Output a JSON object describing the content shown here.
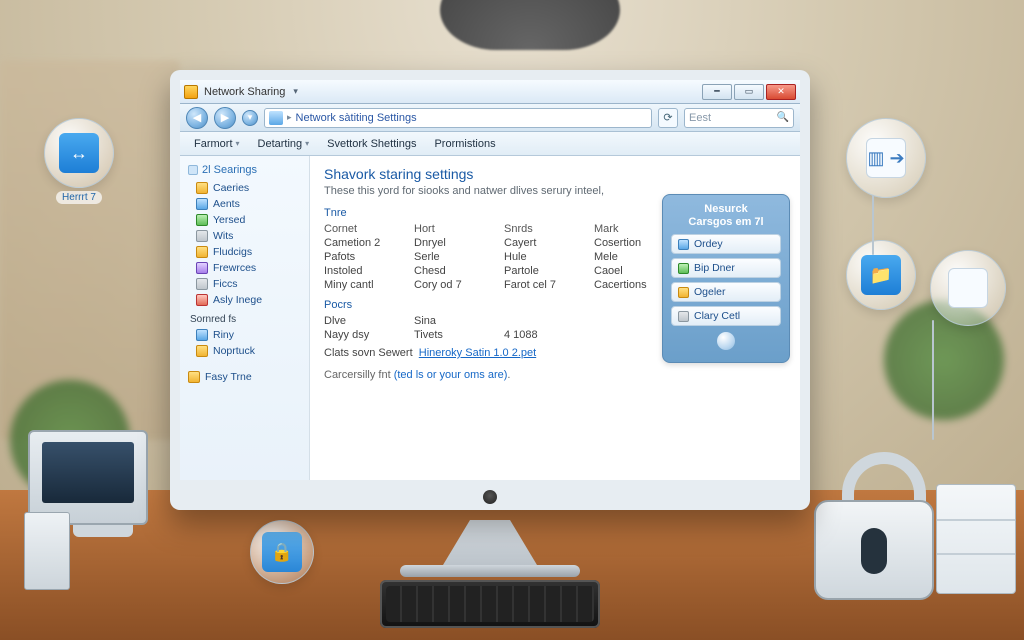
{
  "titlebar": {
    "title": "Network Sharing"
  },
  "breadcrumb": {
    "text": "Network sàtiting Settings"
  },
  "toolbar": {
    "refresh": "⟳",
    "search_placeholder": "Eest"
  },
  "menubar": {
    "items": [
      "Farmort",
      "Detarting",
      "Svettork Shettings",
      "Prormistions"
    ]
  },
  "sidebar": {
    "heading": "2l Searings",
    "items": [
      {
        "icon": "folder",
        "label": "Caeries"
      },
      {
        "icon": "blue",
        "label": "Aents"
      },
      {
        "icon": "green",
        "label": "Yersed"
      },
      {
        "icon": "grey",
        "label": "Wits"
      },
      {
        "icon": "folder",
        "label": "Fludcigs"
      },
      {
        "icon": "purple",
        "label": "Frewrces"
      },
      {
        "icon": "grey",
        "label": "Ficcs"
      },
      {
        "icon": "red",
        "label": "Asly Inege"
      }
    ],
    "subheading": "Sornred fs",
    "sub_items": [
      {
        "icon": "blue",
        "label": "Riny"
      },
      {
        "icon": "folder",
        "label": "Noprtuck"
      }
    ],
    "footer_item": {
      "icon": "folder",
      "label": "Fasy Trne"
    }
  },
  "main": {
    "heading": "Shavork staring settings",
    "desc": "These this yord for siooks and natwer dlives serury inteel,",
    "section1": "Tnre",
    "table": {
      "headers": [
        "Cornet",
        "Hort",
        "Snrds",
        "Mark"
      ],
      "rows": [
        [
          "Cametion 2",
          "Dnryel",
          "Cayert",
          "Cosertion"
        ],
        [
          "Pafots",
          "Serle",
          "Hule",
          "Mele"
        ],
        [
          "Instoled",
          "Chesd",
          "Partole",
          "Caoel"
        ],
        [
          "Miny cantl",
          "Cory od 7",
          "Farot cel 7",
          "Cacertions"
        ]
      ]
    },
    "section2": "Pocrs",
    "table2": {
      "rows": [
        [
          "Dlve",
          "Sina",
          ""
        ],
        [
          "Nayy dsy",
          "Tivets",
          "4 1088"
        ]
      ]
    },
    "link_label": "Clats sovn Sewert",
    "link_text": "Hineroky Satin 1.0 2.pet",
    "hint_prefix": "Carcersilly fnt ",
    "hint_link": "(ted ls or your oms are)",
    "hint_suffix": "."
  },
  "infopanel": {
    "title_l1": "Nesurck",
    "title_l2": "Carsgos em 7l",
    "buttons": [
      {
        "icon": "blue",
        "label": "Ordey"
      },
      {
        "icon": "green",
        "label": "Bip Dner"
      },
      {
        "icon": "folder",
        "label": "Ogeler"
      },
      {
        "icon": "grey",
        "label": "Clary Cetl"
      }
    ]
  },
  "bubbles": {
    "left_caption": "Herrrt 7"
  }
}
